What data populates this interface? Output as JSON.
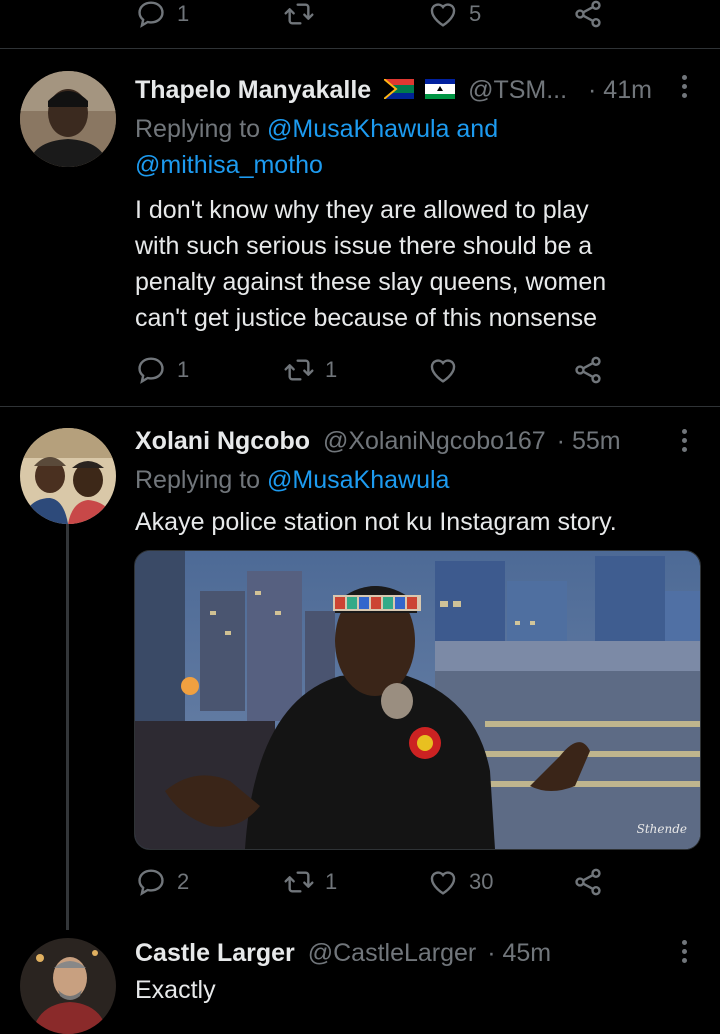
{
  "top_actions": {
    "replies": "1",
    "retweets": "",
    "likes": "5"
  },
  "tweets": [
    {
      "name": "Thapelo Manyakalle",
      "handle": "@TSM...",
      "time": "· 41m",
      "flags": [
        "south-africa-flag",
        "lesotho-flag"
      ],
      "replying_label": "Replying to",
      "reply_to_1": "@MusaKhawula and",
      "reply_to_2": "@mithisa_motho",
      "text_lines": [
        "I don't know why they are allowed to play",
        "with such serious issue there should be a",
        "penalty against these slay queens, women",
        "can't get justice because of this nonsense"
      ],
      "replies": "1",
      "retweets": "1",
      "likes": ""
    },
    {
      "name": "Xolani Ngcobo",
      "handle": "@XolaniNgcobo167",
      "time": "· 55m",
      "replying_label": "Replying to",
      "reply_to_1": "@MusaKhawula",
      "text_lines": [
        "Akaye police station not ku Instagram story."
      ],
      "media_watermark": "Sthende",
      "replies": "2",
      "retweets": "1",
      "likes": "30"
    },
    {
      "name": "Castle Larger",
      "handle": "@CastleLarger",
      "time": "· 45m",
      "text_lines": [
        "Exactly"
      ]
    }
  ],
  "colors": {
    "background": "#000000",
    "text": "#e7e9ea",
    "muted": "#71767b",
    "link": "#1d9bf0",
    "divider": "#2f3336"
  }
}
